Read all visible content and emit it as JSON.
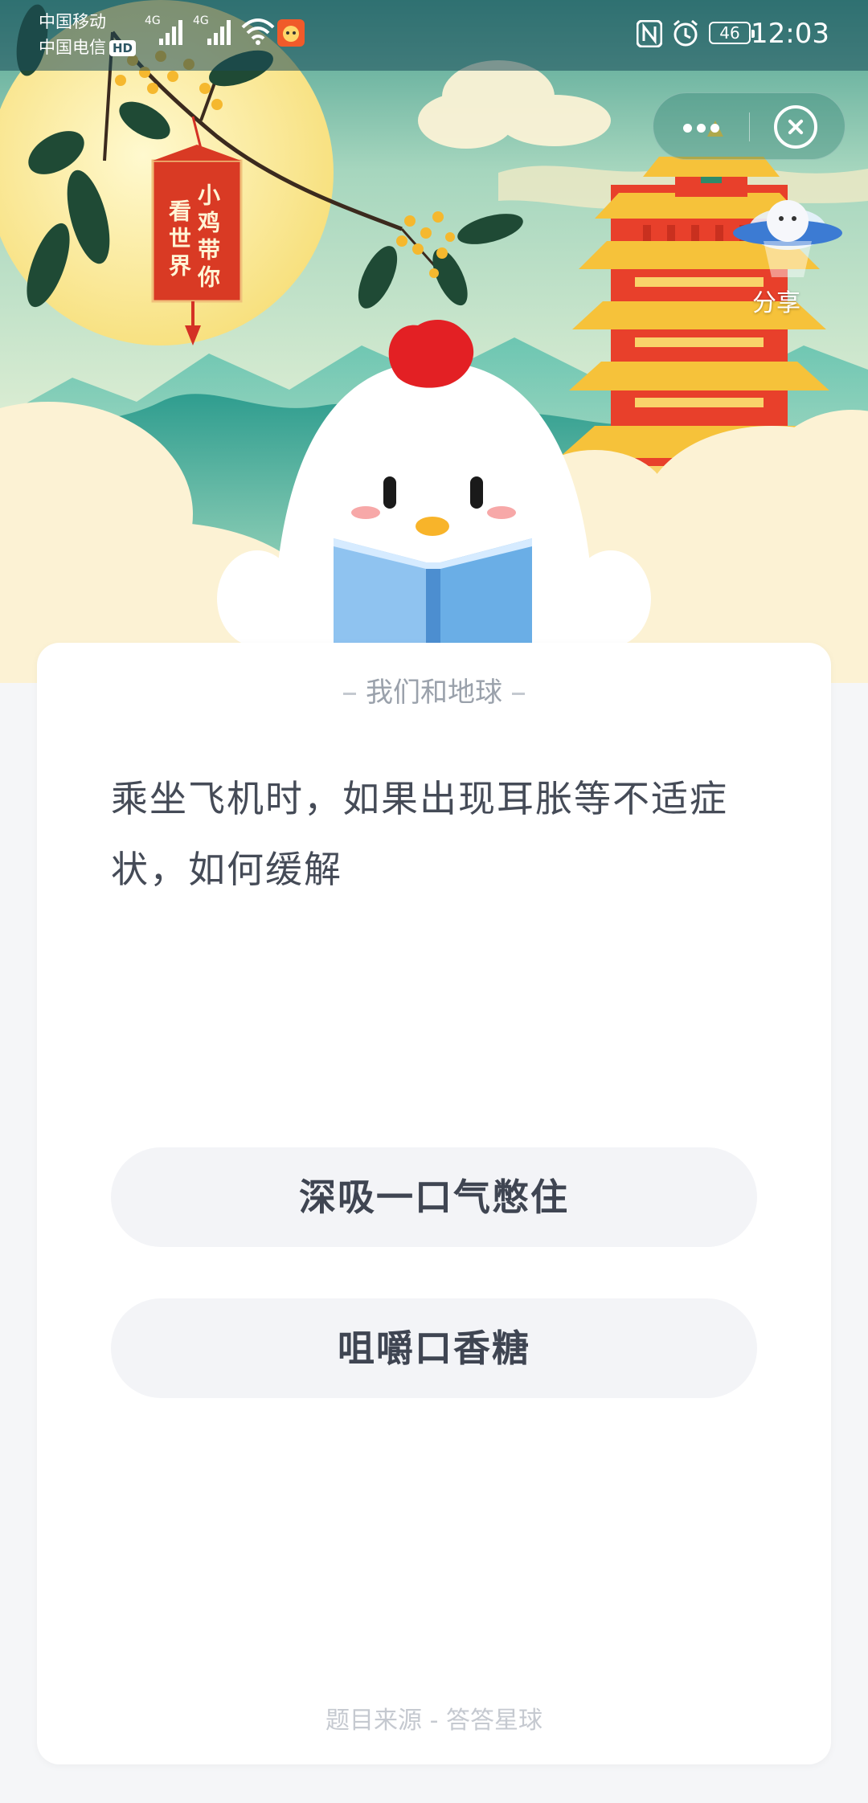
{
  "status_bar": {
    "carrier_1": "中国移动",
    "carrier_2": "中国电信",
    "hd_badge": "HD",
    "signal_type_1": "4G",
    "signal_type_2": "4G",
    "battery_level": "46",
    "time": "12:03"
  },
  "header": {
    "tag_line_1": "小鸡带你",
    "tag_line_2": "看世界",
    "share_label": "分享"
  },
  "quiz": {
    "category": "我们和地球",
    "question": "乘坐飞机时，如果出现耳胀等不适症状，如何缓解",
    "options": [
      {
        "label": "深吸一口气憋住"
      },
      {
        "label": "咀嚼口香糖"
      }
    ],
    "source": "题目来源 - 答答星球"
  },
  "colors": {
    "sky_top": "#f3edc4",
    "mountain": "#3aa99c",
    "tower_red": "#e8402b",
    "tower_gold": "#f6c23a",
    "chick_comb": "#e32024",
    "book_blue": "#6aaee6",
    "card_bg": "#ffffff",
    "option_bg": "#f3f4f7"
  }
}
